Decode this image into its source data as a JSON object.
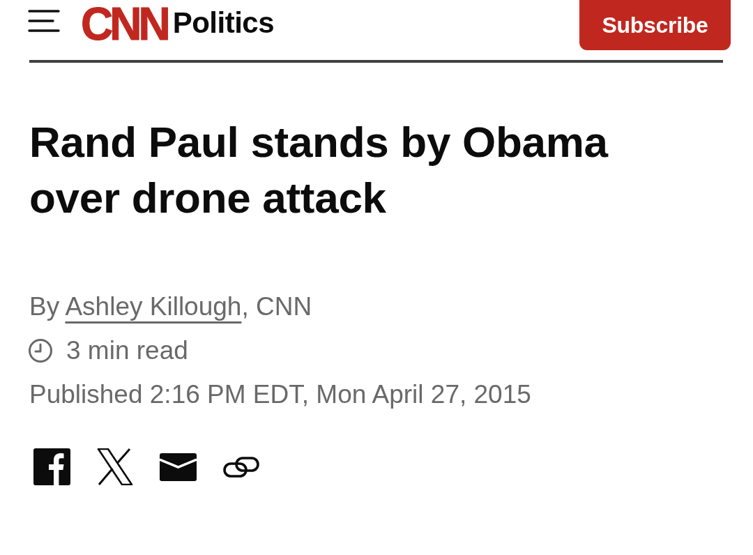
{
  "header": {
    "logo": "CNN",
    "section": "Politics",
    "subscribe_button": "Subscribe"
  },
  "headline": "Rand Paul stands by Obama over drone attack",
  "byline": {
    "before": "By",
    "author": "Ashley Killough",
    "after": ", CNN"
  },
  "read_time": "3 min read",
  "published": "Published 2:16 PM EDT, Mon April 27, 2015"
}
